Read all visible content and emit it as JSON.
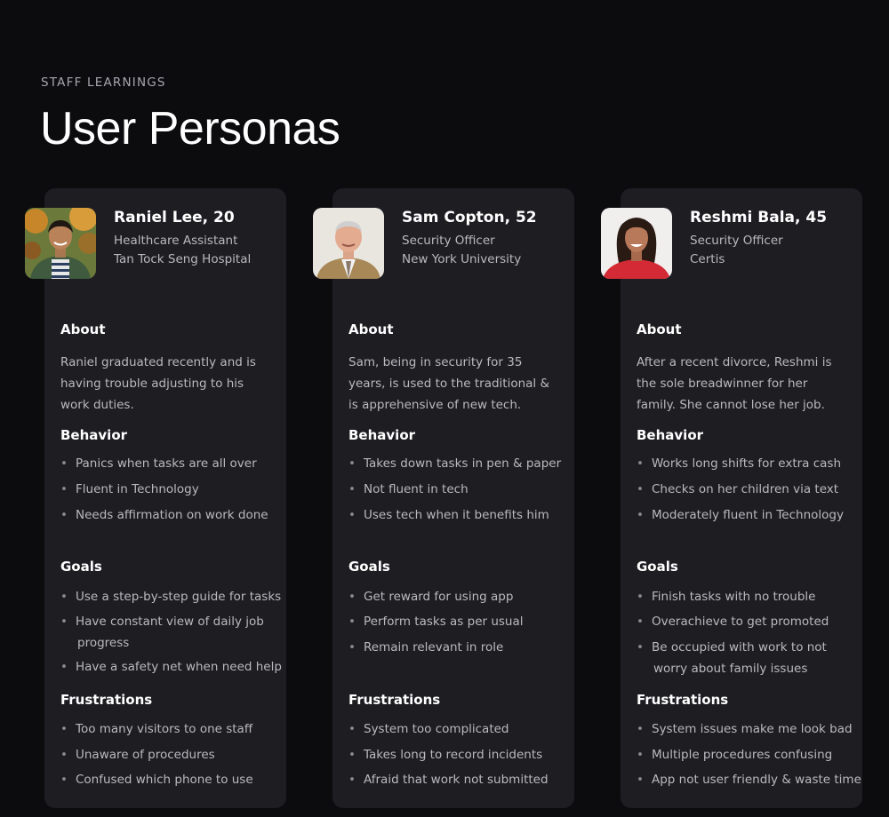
{
  "eyebrow": "STAFF LEARNINGS",
  "title": "User Personas",
  "headings": {
    "about": "About",
    "behavior": "Behavior",
    "goals": "Goals",
    "frustrations": "Frustrations"
  },
  "bullet_char": "•",
  "personas": [
    {
      "name": "Raniel Lee, 20",
      "role": "Healthcare Assistant",
      "organization": "Tan Tock Seng Hospital",
      "about": "Raniel graduated recently and is having trouble adjusting to his work duties.",
      "behavior": [
        "Panics when tasks are all over",
        "Fluent in Technology",
        "Needs affirmation on work done"
      ],
      "goals": [
        "Use a step-by-step guide for tasks",
        "Have constant view of daily job",
        "progress",
        "Have a safety net when need help"
      ],
      "frustrations": [
        "Too many visitors to one staff",
        "Unaware of procedures",
        "Confused which phone to use"
      ]
    },
    {
      "name": "Sam Copton, 52",
      "role": "Security Officer",
      "organization": "New York University",
      "about": "Sam, being in security for 35 years, is used to the traditional & is apprehensive of new tech.",
      "behavior": [
        "Takes down tasks in pen & paper",
        "Not fluent in tech",
        "Uses tech when it benefits him"
      ],
      "goals": [
        "Get reward for using app",
        "Perform tasks as per usual",
        "Remain relevant in role"
      ],
      "frustrations": [
        "System too complicated",
        "Takes long to record incidents",
        "Afraid that work not submitted"
      ]
    },
    {
      "name": "Reshmi Bala, 45",
      "role": "Security Officer",
      "organization": "Certis",
      "about": "After a recent divorce, Reshmi is the sole breadwinner for her family. She cannot lose her job.",
      "behavior": [
        "Works long shifts for extra cash",
        "Checks on her children via text",
        "Moderately fluent in Technology"
      ],
      "goals": [
        "Finish tasks with no trouble",
        "Overachieve to get promoted",
        "Be occupied with work to not",
        "worry about family issues"
      ],
      "frustrations": [
        "System issues make me look bad",
        "Multiple procedures confusing",
        "App not user friendly & waste time"
      ]
    }
  ]
}
